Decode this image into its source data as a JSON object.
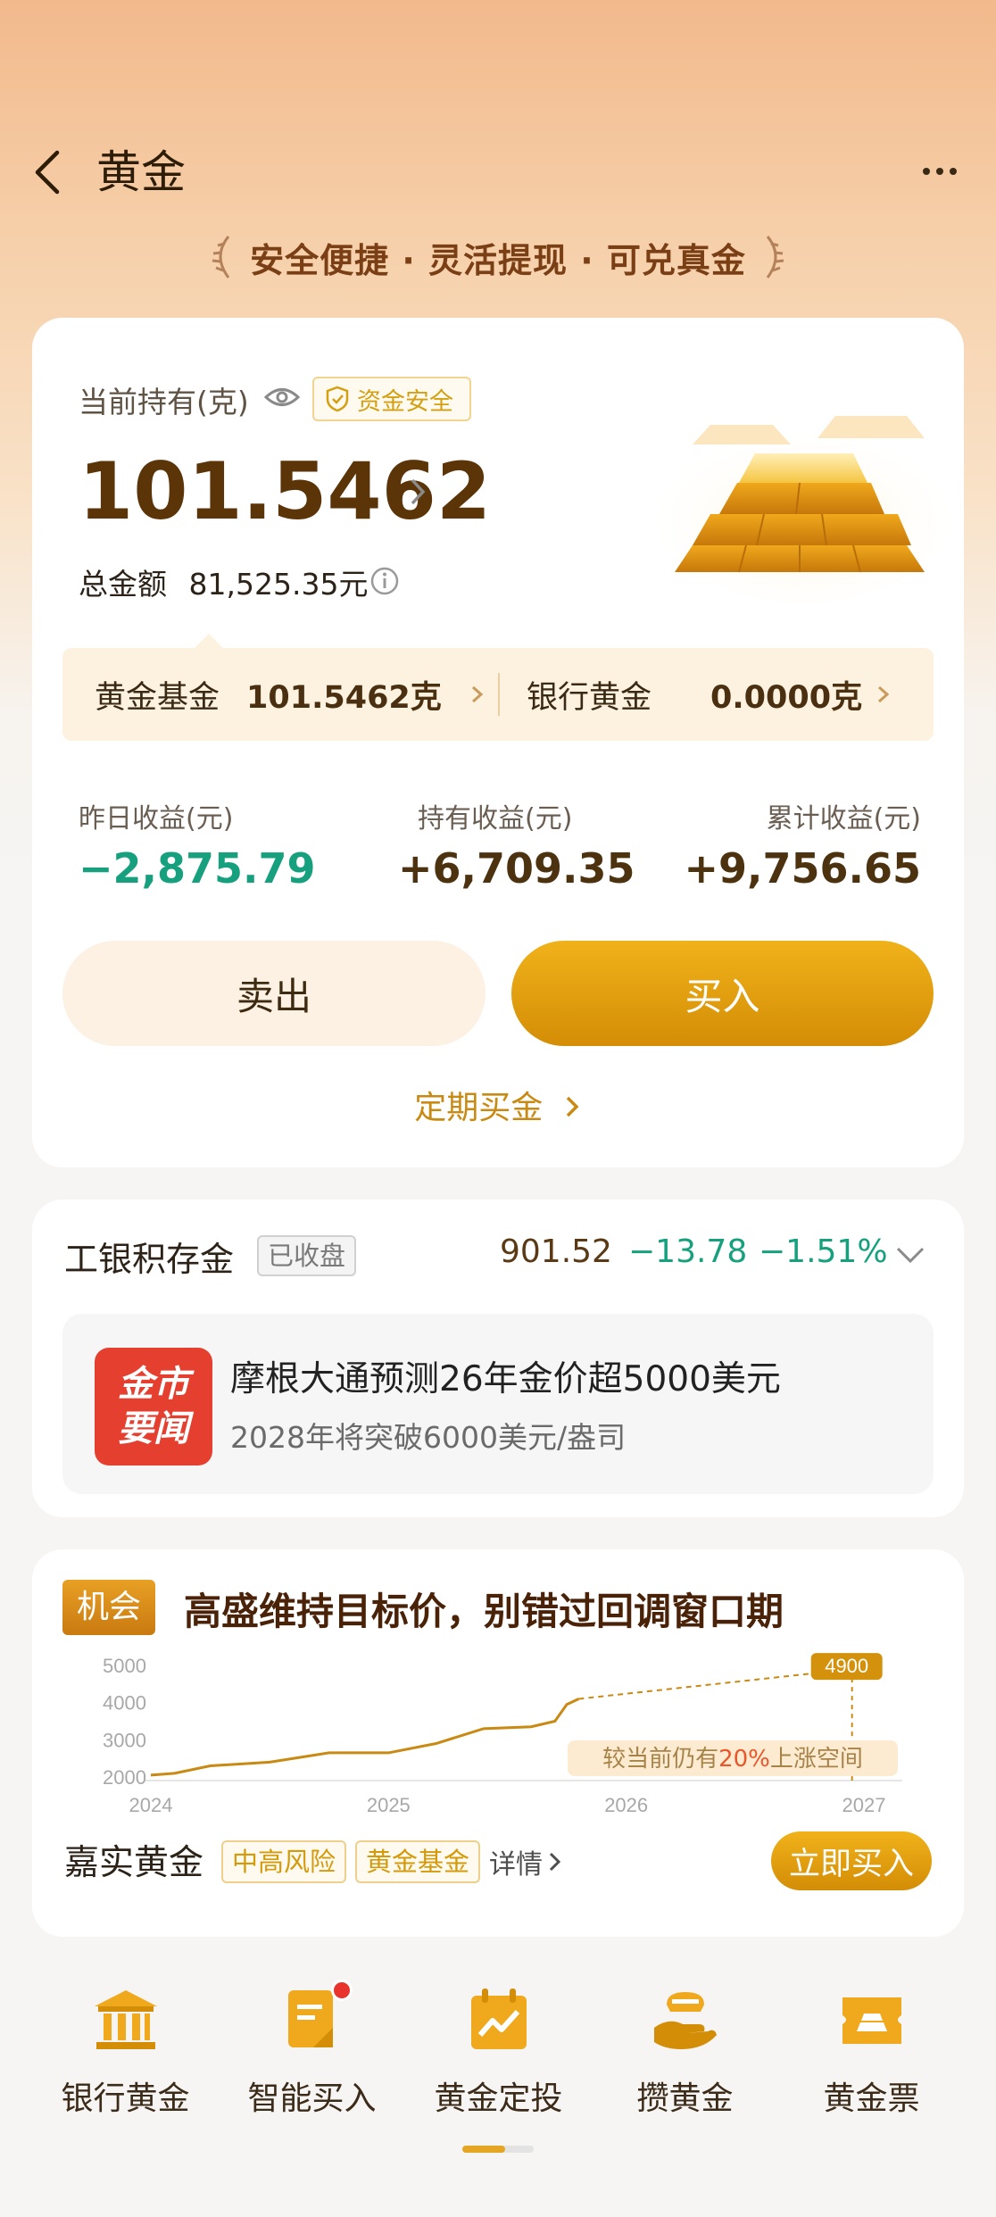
{
  "header": {
    "title": "黄金",
    "tagline": "安全便捷 · 灵活提现 · 可兑真金"
  },
  "holdings": {
    "label": "当前持有(克)",
    "safe_badge": "资金安全",
    "amount": "101.5462",
    "total_label": "总金额",
    "total_value": "81,525.35元"
  },
  "split": {
    "fund_label": "黄金基金",
    "fund_value": "101.5462克",
    "bank_label": "银行黄金",
    "bank_value": "0.0000克"
  },
  "pl": [
    {
      "label": "昨日收益(元)",
      "value": "−2,875.79"
    },
    {
      "label": "持有收益(元)",
      "value": "+6,709.35"
    },
    {
      "label": "累计收益(元)",
      "value": "+9,756.65"
    }
  ],
  "actions": {
    "sell": "卖出",
    "buy": "买入",
    "dca": "定期买金"
  },
  "market": {
    "name": "工银积存金",
    "status": "已收盘",
    "price": "901.52",
    "change": "−13.78",
    "change_pct": "−1.51%",
    "news_logo_line1": "金市",
    "news_logo_line2": "要闻",
    "news_title": "摩根大通预测26年金价超5000美元",
    "news_sub": "2028年将突破6000美元/盎司"
  },
  "opportunity": {
    "tag": "机会",
    "title": "高盛维持目标价，别错过回调窗口期",
    "target_badge": "4900",
    "callout_prefix": "较当前仍有",
    "callout_pct": "20%",
    "callout_suffix": "上涨空间",
    "fund_name": "嘉实黄金",
    "tag_risk": "中高风险",
    "tag_type": "黄金基金",
    "detail": "详情",
    "buy_now": "立即买入"
  },
  "chart_data": {
    "type": "line",
    "x_ticks": [
      "2024",
      "2025",
      "2026",
      "2027"
    ],
    "y_ticks": [
      "5000",
      "4000",
      "3000",
      "2000"
    ],
    "ylim": [
      2000,
      5000
    ],
    "series": [
      {
        "values_x": [
          2024.0,
          2024.1,
          2024.25,
          2024.5,
          2024.75,
          2025.0,
          2025.2,
          2025.4,
          2025.6,
          2025.7,
          2025.75,
          2025.8
        ],
        "values_y": [
          2050,
          2100,
          2300,
          2400,
          2650,
          2650,
          2900,
          3300,
          3350,
          3500,
          3950,
          4100
        ]
      },
      {
        "style": "dashed",
        "values_x": [
          2025.8,
          2026.95
        ],
        "values_y": [
          4100,
          4900
        ]
      }
    ],
    "accent_color": "#c98a14"
  },
  "nav": [
    {
      "label": "银行黄金",
      "icon": "bank-icon"
    },
    {
      "label": "智能买入",
      "icon": "smart-buy-icon"
    },
    {
      "label": "黄金定投",
      "icon": "calendar-chart-icon"
    },
    {
      "label": "攒黄金",
      "icon": "hand-coin-icon"
    },
    {
      "label": "黄金票",
      "icon": "ticket-icon"
    }
  ]
}
